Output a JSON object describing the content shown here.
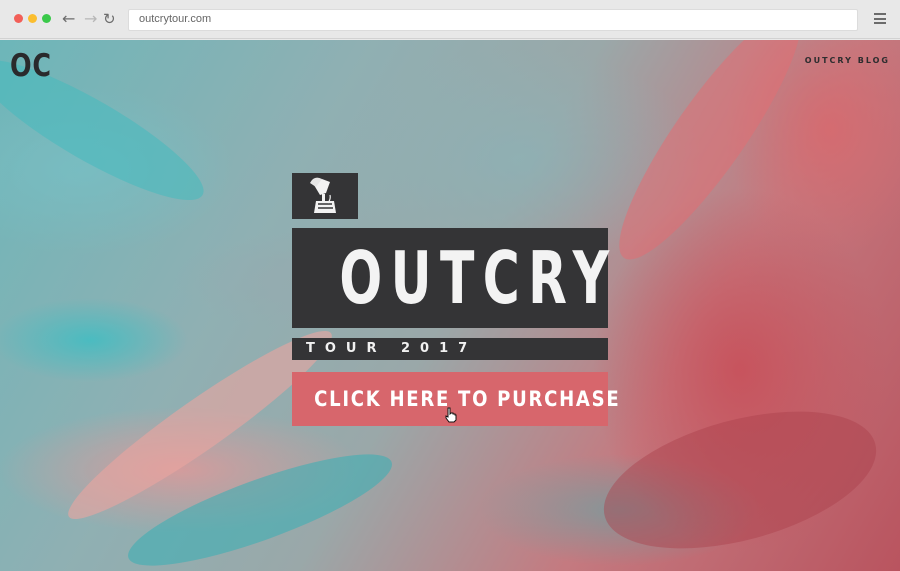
{
  "browser": {
    "url": "outcrytour.com",
    "icons": [
      "back-arrow-icon",
      "forward-arrow-icon",
      "reload-icon",
      "hamburger-menu-icon"
    ]
  },
  "site": {
    "logo": "OC",
    "nav_link": "OUTCRY BLOG",
    "emblem_icon": "gramophone-icon",
    "title": "OUTCRY",
    "subtitle": "TOUR 2017",
    "cta_label": "CLICK HERE TO PURCHASE"
  },
  "colors": {
    "panel": "#343436",
    "cta": "#d7666c",
    "text_light": "#f3f3f3"
  }
}
